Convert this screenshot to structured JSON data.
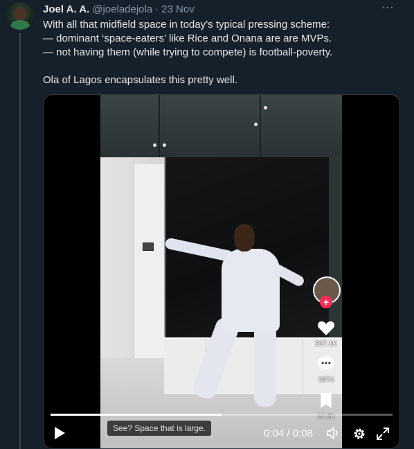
{
  "tweet": {
    "author_name": "Joel A. A.",
    "handle": "@joeladejola",
    "separator": "·",
    "date": "23 Nov",
    "more_label": "···",
    "lines": [
      "With all that midfield space in today’s typical pressing scheme:",
      "— dominant ‘space-eaters’ like Rice and Onana are are MVPs.",
      "— not having them (while trying to compete) is football-poverty."
    ],
    "closing": "Ola of Lagos encapsulates this pretty well."
  },
  "video": {
    "caption": "See? Space that is large.",
    "current_time": "0:04",
    "time_separator": " / ",
    "duration": "0:08",
    "progress_fraction": 0.5,
    "tiktok": {
      "likes": "267.1K",
      "comments": "9874",
      "saves": "13.3K"
    }
  },
  "colors": {
    "background": "#15202b",
    "text": "#e7e9ea",
    "muted": "#8b98a5",
    "tiktok_red": "#fe2c55"
  },
  "icons": [
    "avatar",
    "more-icon",
    "play-icon",
    "volume-icon",
    "gear-icon",
    "fullscreen-icon",
    "heart-icon",
    "comment-icon",
    "bookmark-icon",
    "plus-icon"
  ]
}
